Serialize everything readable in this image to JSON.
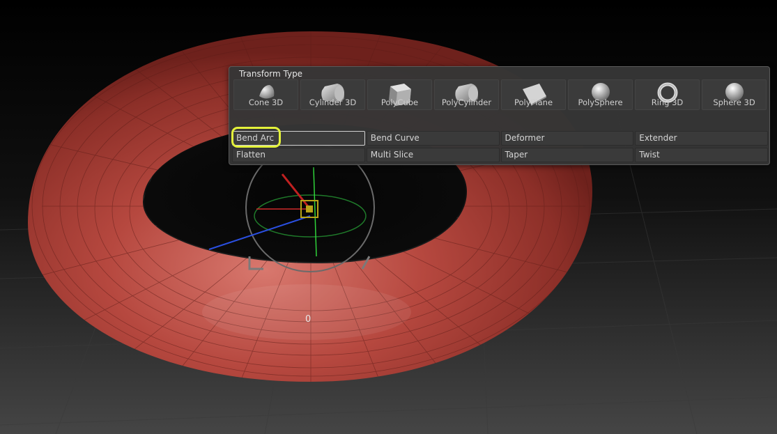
{
  "panel": {
    "title": "Transform Type",
    "tools": [
      {
        "label": "Cone 3D",
        "icon": "cone-3d-icon"
      },
      {
        "label": "Cylinder 3D",
        "icon": "cylinder-3d-icon"
      },
      {
        "label": "PolyCube",
        "icon": "polycube-icon"
      },
      {
        "label": "PolyCylinder",
        "icon": "polycylinder-icon"
      },
      {
        "label": "PolyPlane",
        "icon": "polyplane-icon"
      },
      {
        "label": "PolySphere",
        "icon": "polysphere-icon"
      },
      {
        "label": "Ring 3D",
        "icon": "ring-3d-icon"
      },
      {
        "label": "Sphere 3D",
        "icon": "sphere-3d-icon"
      }
    ],
    "deformers": [
      {
        "label": "Bend Arc"
      },
      {
        "label": "Bend Curve"
      },
      {
        "label": "Deformer"
      },
      {
        "label": "Extender"
      },
      {
        "label": "Flatten"
      },
      {
        "label": "Multi Slice"
      },
      {
        "label": "Taper"
      },
      {
        "label": "Twist"
      }
    ]
  },
  "viewport": {
    "readout": "0"
  },
  "colors": {
    "torus": "#b5443c",
    "highlight": "#e4f23a",
    "panel_bg": "#363636"
  }
}
